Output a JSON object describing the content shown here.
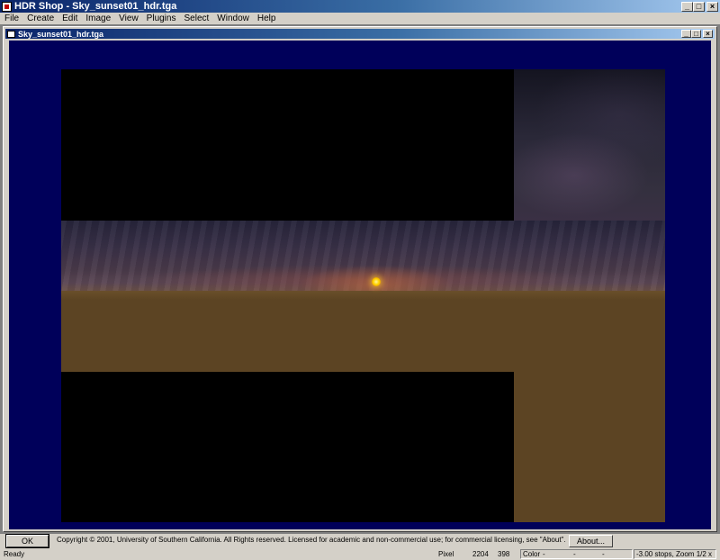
{
  "app": {
    "title": "HDR Shop - Sky_sunset01_hdr.tga",
    "icon": "hdr-shop-app-icon"
  },
  "window_buttons": {
    "minimize": "_",
    "maximize": "□",
    "close": "×"
  },
  "menu": {
    "items": [
      "File",
      "Create",
      "Edit",
      "Image",
      "View",
      "Plugins",
      "Select",
      "Window",
      "Help"
    ]
  },
  "document": {
    "title": "Sky_sunset01_hdr.tga"
  },
  "info_bar": {
    "ok_label": "OK",
    "copyright": "Copyright © 2001, University of Southern California.  All Rights reserved.  Licensed for academic and non-commercial use; for commercial licensing, see \"About\".",
    "about_label": "About..."
  },
  "status": {
    "ready": "Ready",
    "pixel_label": "Pixel",
    "pixel_x": "2204",
    "pixel_y": "398",
    "color_label": "Color",
    "color_r": "-",
    "color_g": "-",
    "color_b": "-",
    "exposure_zoom": "-3.00 stops, Zoom 1/2 x"
  },
  "colors": {
    "titlebar_start": "#0a246a",
    "titlebar_end": "#a6caf0",
    "canvas_background": "#00005a",
    "ground": "#5c4423",
    "sun": "#ffd400"
  }
}
